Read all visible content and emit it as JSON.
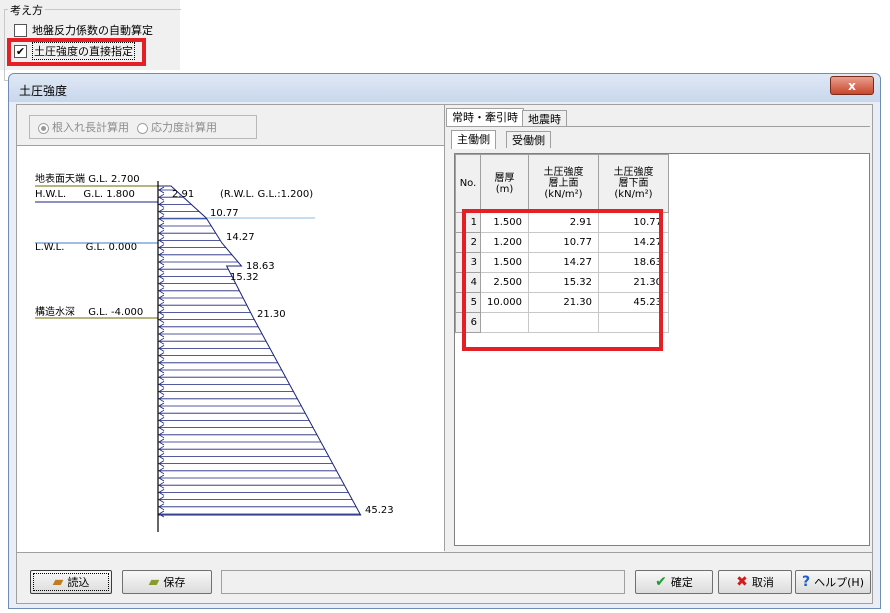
{
  "group": {
    "title": "考え方",
    "options": [
      {
        "label": "地盤反力係数の自動算定",
        "checked": false
      },
      {
        "label": "土圧強度の直接指定",
        "checked": true
      }
    ]
  },
  "dialog": {
    "title": "土圧強度",
    "close_label": "x"
  },
  "calc_mode": {
    "option1": "根入れ長計算用",
    "option2": "応力度計算用",
    "selected": "option1"
  },
  "diagram": {
    "levels": [
      {
        "name": "地表面天端",
        "gl": "G.L. 2.700"
      },
      {
        "name": "H.W.L.",
        "gl": "G.L. 1.800"
      },
      {
        "name": "L.W.L.",
        "gl": "G.L. 0.000"
      },
      {
        "name": "構造水深",
        "gl": "G.L. -4.000"
      }
    ],
    "rwl_note": "(R.W.L. G.L.:1.200)",
    "value_labels": [
      "2.91",
      "10.77",
      "14.27",
      "18.63",
      "15.32",
      "21.30",
      "45.23"
    ]
  },
  "tabs": {
    "main": [
      "常時・牽引時",
      "地震時"
    ],
    "sub": [
      "主働側",
      "受働側"
    ]
  },
  "table": {
    "headers": {
      "no": "No.",
      "thickness": [
        "層厚",
        "(m)"
      ],
      "top": [
        "土圧強度",
        "層上面",
        "(kN/m²)"
      ],
      "bottom": [
        "土圧強度",
        "層下面",
        "(kN/m²)"
      ]
    },
    "rows": [
      {
        "no": "1",
        "thickness": "1.500",
        "top": "2.91",
        "bottom": "10.77"
      },
      {
        "no": "2",
        "thickness": "1.200",
        "top": "10.77",
        "bottom": "14.27"
      },
      {
        "no": "3",
        "thickness": "1.500",
        "top": "14.27",
        "bottom": "18.63"
      },
      {
        "no": "4",
        "thickness": "2.500",
        "top": "15.32",
        "bottom": "21.30"
      },
      {
        "no": "5",
        "thickness": "10.000",
        "top": "21.30",
        "bottom": "45.23"
      },
      {
        "no": "6",
        "thickness": "",
        "top": "",
        "bottom": ""
      }
    ]
  },
  "buttons": {
    "read": "読込",
    "save": "保存",
    "ok": "確定",
    "cancel": "取消",
    "help": "ヘルプ(H)"
  },
  "colors": {
    "highlight": "#e51f26",
    "diagram_line": "#1a237e",
    "water_line": "#3c7dc4",
    "level_line": "#6b6b00"
  }
}
